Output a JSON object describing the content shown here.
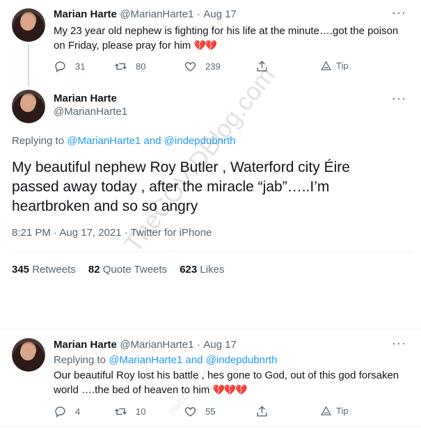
{
  "tweet1": {
    "name": "Marian Harte",
    "handle": "@MarianHarte1",
    "sep": "·",
    "date": "Aug 17",
    "text_line1": "My 23 year old nephew is fighting for his life at the minute….got the poison",
    "text_line2": "on Friday, please pray for him",
    "hearts": "💔💔",
    "replies": "31",
    "retweets": "80",
    "likes": "239",
    "tip": "Tip",
    "more": "···"
  },
  "tweet2": {
    "name": "Marian Harte",
    "handle": "@MarianHarte1",
    "more": "···",
    "replying_to": "Replying to",
    "reply_handle1": "@MarianHarte1",
    "and": "and",
    "reply_handle2": "@indepdubnrth",
    "text_line1": "My beautiful nephew Roy Butler , Waterford city Éire",
    "text_line2": "passed away today , after the miracle “jab”…..I’m",
    "text_line3": "heartbroken and so so angry",
    "time": "8:21 PM · Aug 17, 2021 · Twitter for iPhone",
    "retweets_count": "345",
    "retweets_label": "Retweets",
    "quotes_count": "82",
    "quotes_label": "Quote Tweets",
    "likes_count": "623",
    "likes_label": "Likes"
  },
  "tweet3": {
    "name": "Marian Harte",
    "handle": "@MarianHarte1",
    "sep": "·",
    "date": "Aug 17",
    "more": "···",
    "replying_to": "Replying to",
    "reply_handle1": "@MarianHarte1",
    "and": "and",
    "reply_handle2": "@indepdubnrth",
    "text_line1": "Our beautiful Roy lost his battle , hes gone to God, out of this god forsaken",
    "text_line2": "world ….the bed of heaven to him",
    "hearts": "💔💔💔",
    "replies": "4",
    "retweets": "10",
    "likes": "55",
    "tip": "Tip"
  },
  "watermark": {
    "main": "TheCOVIDBlog.com",
    "small": "TheCOVIDBlog.com"
  },
  "colors": {
    "link": "#1d9bf0",
    "muted": "#536471",
    "text": "#0f1419",
    "heart": "#c8202f"
  }
}
